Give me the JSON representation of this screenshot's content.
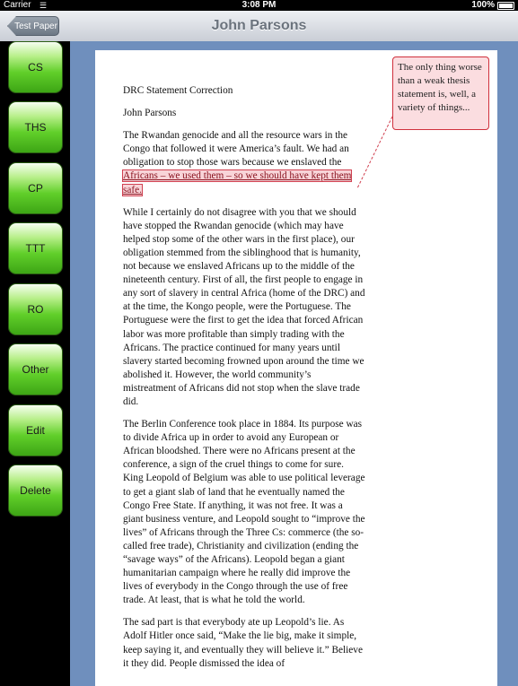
{
  "status_bar": {
    "carrier": "Carrier",
    "time": "3:08 PM",
    "battery": "100%"
  },
  "nav": {
    "back_label": "Test Paper",
    "title": "John Parsons"
  },
  "side_buttons": [
    {
      "label": "CS"
    },
    {
      "label": "THS"
    },
    {
      "label": "CP"
    },
    {
      "label": "TTT"
    },
    {
      "label": "RO"
    },
    {
      "label": "Other"
    },
    {
      "label": "Edit"
    },
    {
      "label": "Delete"
    }
  ],
  "document": {
    "title": "DRC Statement Correction",
    "author": "John Parsons",
    "p1_before": "The Rwandan genocide and all the resource wars in the Congo that followed it were America’s fault. We had an obligation to stop those wars because we enslaved the ",
    "p1_highlight": "Africans – we used them – so we should have kept them safe.",
    "p2": "While I certainly do not disagree with you that we should have stopped the Rwandan genocide (which may have helped stop some of the other wars in the first place), our obligation stemmed from the siblinghood that is humanity, not because we enslaved Africans up to the middle of the nineteenth century. First of all, the first people to engage in any sort of slavery in central Africa (home of the DRC) and at the time, the Kongo people, were the Portuguese. The Portuguese were the first to get the idea that forced African labor was more profitable than simply trading with the Africans. The practice continued for many years until slavery started becoming frowned upon around the time we abolished it. However, the world community’s mistreatment of Africans did not stop when the slave trade did.",
    "p3": "The Berlin Conference took place in 1884. Its purpose was to divide Africa up in order to avoid any European or African bloodshed. There were no Africans present at the conference, a sign of the cruel things to come for sure. King Leopold of Belgium was able to use political leverage to get a giant slab of land that he eventually named the Congo Free State. If anything, it was not free. It was a giant business venture, and Leopold sought to “improve the lives” of Africans through the Three Cs: commerce (the so-called free trade), Christianity and civilization (ending the “savage ways” of the Africans). Leopold began a giant humanitarian campaign where he really did improve the lives of everybody in the Congo through the use of free trade. At least, that is what he told the world.",
    "p4": "The sad part is that everybody ate up Leopold’s lie. As Adolf Hitler once said, “Make the lie big, make it simple, keep saying it, and eventually they will believe it.” Believe it they did. People dismissed the idea of"
  },
  "comment": {
    "text": "The only thing worse than a weak thesis statement is, well, a variety of things..."
  },
  "colors": {
    "highlight_fill": "#f8d4d8",
    "highlight_border": "#d04050",
    "content_background": "#6f8fbd",
    "button_green": "#61cf2a"
  }
}
